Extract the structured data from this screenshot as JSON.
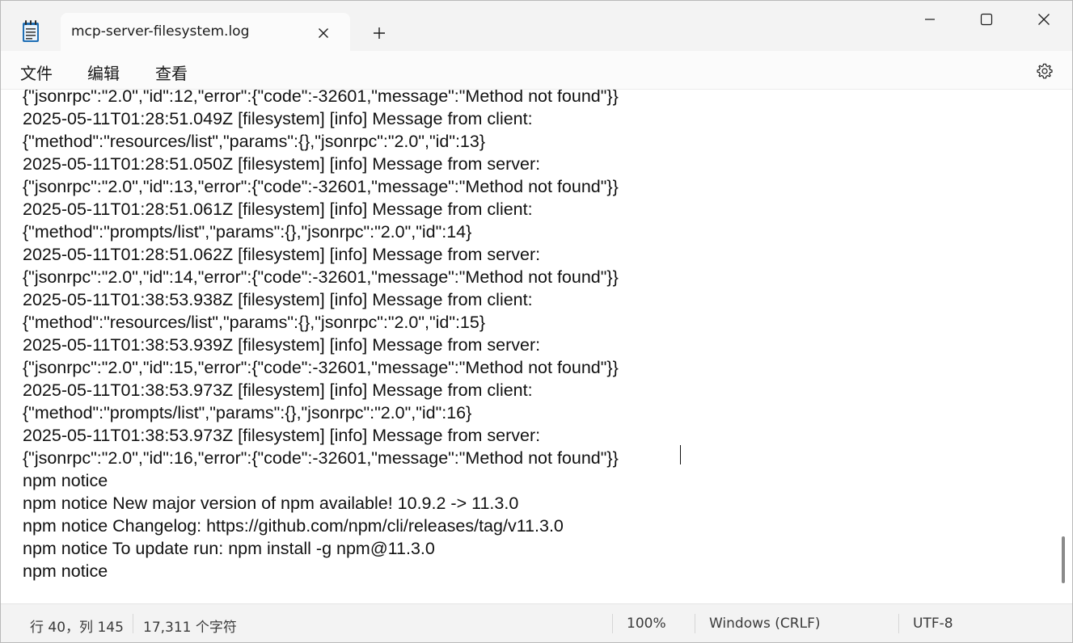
{
  "window": {
    "tab_title": "mcp-server-filesystem.log",
    "app_icon": "notepad-icon",
    "new_tab_icon": "plus-icon",
    "close_tab_icon": "close-icon",
    "minimize_icon": "minimize-icon",
    "maximize_icon": "maximize-icon",
    "close_window_icon": "close-icon"
  },
  "menu": {
    "file": "文件",
    "edit": "编辑",
    "view": "查看",
    "settings_icon": "gear-icon"
  },
  "editor": {
    "lines": [
      "{\"jsonrpc\":\"2.0\",\"id\":12,\"error\":{\"code\":-32601,\"message\":\"Method not found\"}}",
      "2025-05-11T01:28:51.049Z [filesystem] [info] Message from client:",
      "{\"method\":\"resources/list\",\"params\":{},\"jsonrpc\":\"2.0\",\"id\":13}",
      "2025-05-11T01:28:51.050Z [filesystem] [info] Message from server:",
      "{\"jsonrpc\":\"2.0\",\"id\":13,\"error\":{\"code\":-32601,\"message\":\"Method not found\"}}",
      "2025-05-11T01:28:51.061Z [filesystem] [info] Message from client:",
      "{\"method\":\"prompts/list\",\"params\":{},\"jsonrpc\":\"2.0\",\"id\":14}",
      "2025-05-11T01:28:51.062Z [filesystem] [info] Message from server:",
      "{\"jsonrpc\":\"2.0\",\"id\":14,\"error\":{\"code\":-32601,\"message\":\"Method not found\"}}",
      "2025-05-11T01:38:53.938Z [filesystem] [info] Message from client:",
      "{\"method\":\"resources/list\",\"params\":{},\"jsonrpc\":\"2.0\",\"id\":15}",
      "2025-05-11T01:38:53.939Z [filesystem] [info] Message from server:",
      "{\"jsonrpc\":\"2.0\",\"id\":15,\"error\":{\"code\":-32601,\"message\":\"Method not found\"}}",
      "2025-05-11T01:38:53.973Z [filesystem] [info] Message from client:",
      "{\"method\":\"prompts/list\",\"params\":{},\"jsonrpc\":\"2.0\",\"id\":16}",
      "2025-05-11T01:38:53.973Z [filesystem] [info] Message from server:",
      "{\"jsonrpc\":\"2.0\",\"id\":16,\"error\":{\"code\":-32601,\"message\":\"Method not found\"}}",
      "npm notice",
      "npm notice New major version of npm available! 10.9.2 -> 11.3.0",
      "npm notice Changelog: https://github.com/npm/cli/releases/tag/v11.3.0",
      "npm notice To update run: npm install -g npm@11.3.0",
      "npm notice"
    ]
  },
  "status": {
    "position": "行 40，列 145",
    "char_count": "17,311 个字符",
    "zoom": "100%",
    "line_ending": "Windows (CRLF)",
    "encoding": "UTF-8"
  },
  "colors": {
    "titlebar_bg": "#f3f3f3",
    "tab_bg": "#fbfbfb",
    "editor_bg": "#ffffff",
    "statusbar_bg": "#f3f3f3",
    "app_icon_blue": "#1f6fb5"
  }
}
